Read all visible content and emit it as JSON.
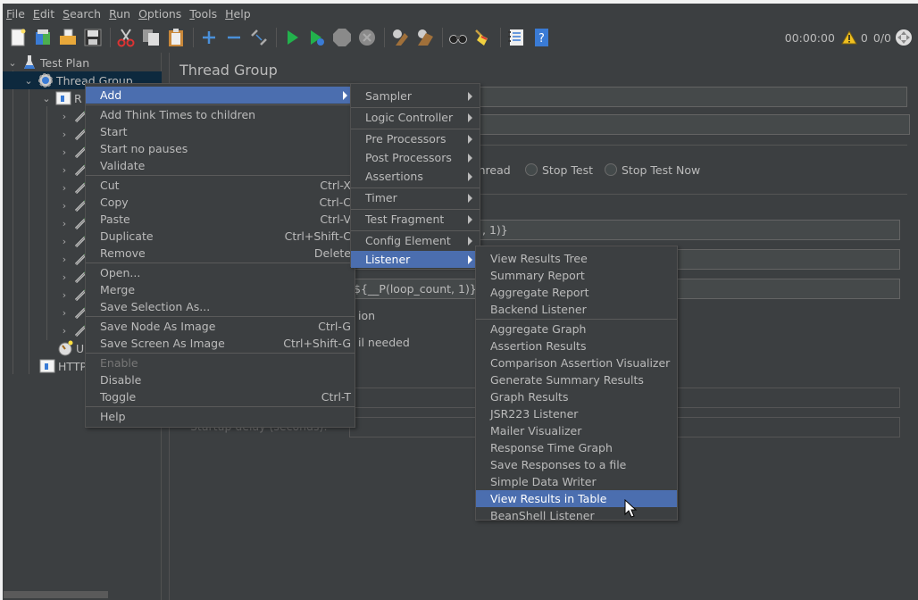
{
  "menubar": [
    {
      "label": "File",
      "mnemonic": "F",
      "rest": "ile"
    },
    {
      "label": "Edit",
      "mnemonic": "E",
      "rest": "dit"
    },
    {
      "label": "Search",
      "mnemonic": "S",
      "rest": "earch"
    },
    {
      "label": "Run",
      "mnemonic": "R",
      "rest": "un"
    },
    {
      "label": "Options",
      "mnemonic": "O",
      "rest": "ptions"
    },
    {
      "label": "Tools",
      "mnemonic": "T",
      "rest": "ools"
    },
    {
      "label": "Help",
      "mnemonic": "H",
      "rest": "elp"
    }
  ],
  "toolbar": {
    "buttons": [
      "new-icon",
      "templates-icon",
      "open-icon",
      "save-icon",
      "cut-icon",
      "copy-icon",
      "paste-icon",
      "expand-icon",
      "collapse-icon",
      "toggle-icon",
      "start-icon",
      "start-no-pauses-icon",
      "stop-icon",
      "shutdown-icon",
      "clear-icon",
      "clear-all-icon",
      "search-icon",
      "reset-search-icon",
      "function-helper-icon",
      "help-icon"
    ],
    "elapsed_time": "00:00:00",
    "warning_count": "0",
    "active_threads": "0/0"
  },
  "tree": {
    "items": [
      {
        "label": "Test Plan",
        "icon": "test-plan-icon"
      },
      {
        "label": "Thread Group",
        "icon": "thread-group-icon"
      },
      {
        "label": "R",
        "icon": "controller-icon"
      },
      {
        "label": "U",
        "icon": "timer-icon"
      },
      {
        "label": "HTTP",
        "icon": "config-icon"
      }
    ]
  },
  "main": {
    "title": "Thread Group",
    "radio_thread": "Thread",
    "radio_stop_test": "Stop Test",
    "radio_stop_test_now": "Stop Test Now",
    "field_partial_1": ", 1)}",
    "field_loop": "${__P(loop_count, 1)}",
    "text_ion": "ion",
    "text_needed": "il needed",
    "startup_delay": "Startup delay (seconds):"
  },
  "context_menu": {
    "items": [
      {
        "label": "Add",
        "submenu": true,
        "highlighted": true
      },
      {
        "sep": true
      },
      {
        "label": "Add Think Times to children"
      },
      {
        "label": "Start"
      },
      {
        "label": "Start no pauses"
      },
      {
        "label": "Validate"
      },
      {
        "sep": true
      },
      {
        "label": "Cut",
        "shortcut": "Ctrl-X"
      },
      {
        "label": "Copy",
        "shortcut": "Ctrl-C"
      },
      {
        "label": "Paste",
        "shortcut": "Ctrl-V"
      },
      {
        "label": "Duplicate",
        "shortcut": "Ctrl+Shift-C"
      },
      {
        "label": "Remove",
        "shortcut": "Delete"
      },
      {
        "sep": true
      },
      {
        "label": "Open..."
      },
      {
        "label": "Merge"
      },
      {
        "label": "Save Selection As..."
      },
      {
        "sep": true
      },
      {
        "label": "Save Node As Image",
        "shortcut": "Ctrl-G"
      },
      {
        "label": "Save Screen As Image",
        "shortcut": "Ctrl+Shift-G"
      },
      {
        "sep": true
      },
      {
        "label": "Enable",
        "disabled": true
      },
      {
        "label": "Disable"
      },
      {
        "label": "Toggle",
        "shortcut": "Ctrl-T"
      },
      {
        "sep": true
      },
      {
        "label": "Help"
      }
    ]
  },
  "add_submenu": {
    "items": [
      {
        "label": "Sampler"
      },
      {
        "label": "Logic Controller"
      },
      {
        "label": "Pre Processors"
      },
      {
        "label": "Post Processors"
      },
      {
        "label": "Assertions"
      },
      {
        "label": "Timer"
      },
      {
        "label": "Test Fragment"
      },
      {
        "label": "Config Element"
      },
      {
        "label": "Listener",
        "highlighted": true
      }
    ]
  },
  "listener_submenu": {
    "items": [
      {
        "label": "View Results Tree"
      },
      {
        "label": "Summary Report"
      },
      {
        "label": "Aggregate Report"
      },
      {
        "label": "Backend Listener"
      },
      {
        "label": "Aggregate Graph"
      },
      {
        "label": "Assertion Results"
      },
      {
        "label": "Comparison Assertion Visualizer"
      },
      {
        "label": "Generate Summary Results"
      },
      {
        "label": "Graph Results"
      },
      {
        "label": "JSR223 Listener"
      },
      {
        "label": "Mailer Visualizer"
      },
      {
        "label": "Response Time Graph"
      },
      {
        "label": "Save Responses to a file"
      },
      {
        "label": "Simple Data Writer"
      },
      {
        "label": "View Results in Table",
        "highlighted": true
      },
      {
        "label": "BeanShell Listener"
      }
    ]
  },
  "colors": {
    "background": "#3c3f41",
    "highlight": "#4b6eaf",
    "tree_selection": "#0d293e",
    "text": "#bbbbbb"
  }
}
